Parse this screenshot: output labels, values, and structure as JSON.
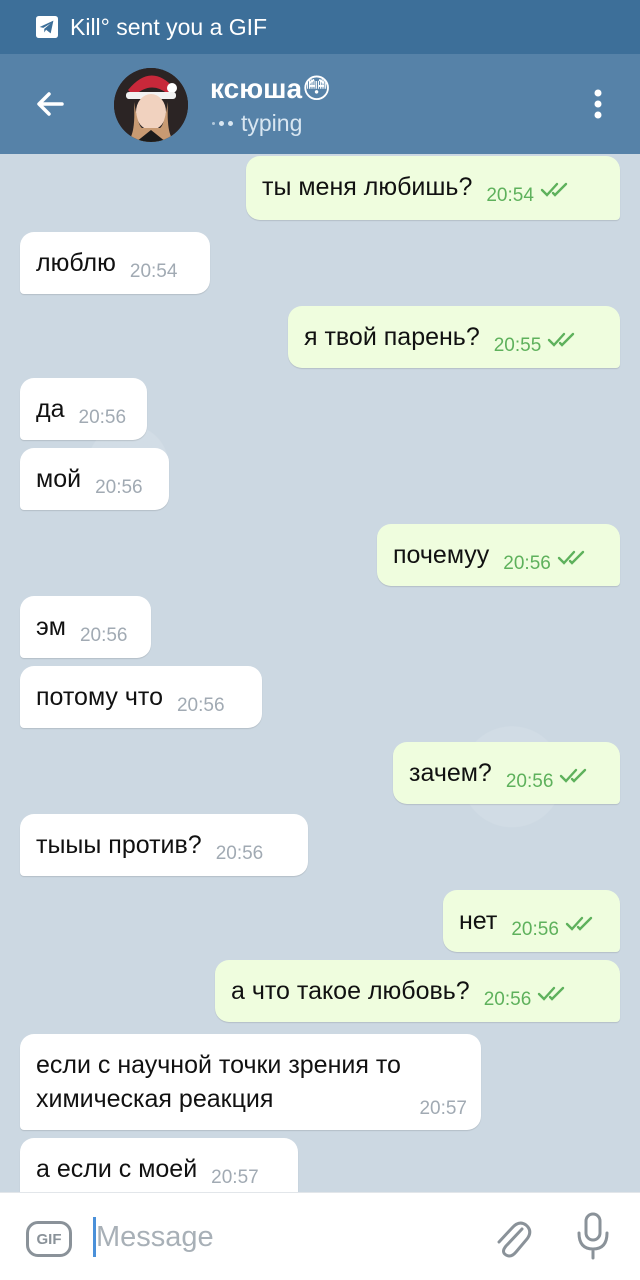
{
  "status_bar": {
    "notification": "Kill° sent you a GIF"
  },
  "header": {
    "name": "ксюша😳",
    "status": "typing"
  },
  "messages": [
    {
      "dir": "out",
      "text": "ты меня любишь?",
      "time": "20:54"
    },
    {
      "dir": "in",
      "text": "люблю",
      "time": "20:54"
    },
    {
      "dir": "out",
      "text": "я твой парень?",
      "time": "20:55"
    },
    {
      "dir": "in",
      "text": "да",
      "time": "20:56"
    },
    {
      "dir": "in",
      "text": "мой",
      "time": "20:56"
    },
    {
      "dir": "out",
      "text": "почемуу",
      "time": "20:56"
    },
    {
      "dir": "in",
      "text": "эм",
      "time": "20:56"
    },
    {
      "dir": "in",
      "text": "потому что",
      "time": "20:56"
    },
    {
      "dir": "out",
      "text": "зачем?",
      "time": "20:56"
    },
    {
      "dir": "in",
      "text": "тыыы против?",
      "time": "20:56"
    },
    {
      "dir": "out",
      "text": "нет",
      "time": "20:56"
    },
    {
      "dir": "out",
      "text": "а что такое любовь?",
      "time": "20:56"
    },
    {
      "dir": "in",
      "text": "если с научной точки зрения то химическая реакция",
      "time": "20:57"
    },
    {
      "dir": "in",
      "text": "а если с моей",
      "time": "20:57"
    }
  ],
  "composer": {
    "gif_label": "GIF",
    "placeholder": "Message"
  },
  "colors": {
    "header": "#5682a8",
    "status_bar": "#3d6f99",
    "outgoing_bubble": "#effdde",
    "incoming_bubble": "#ffffff",
    "read_ticks": "#5eb15c"
  }
}
